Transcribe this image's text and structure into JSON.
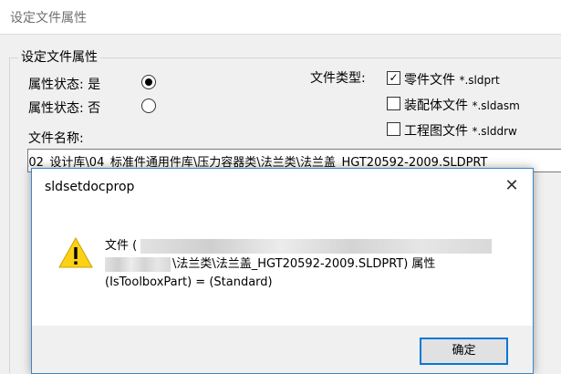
{
  "window": {
    "title": "设定文件属性"
  },
  "group": {
    "title": "设定文件属性"
  },
  "status": {
    "yes_label": "属性状态: 是",
    "no_label": "属性状态: 否",
    "selected": "yes"
  },
  "file_type": {
    "label": "文件类型:",
    "options": [
      {
        "name": "零件文件",
        "ext": "*.sldprt",
        "checked": true
      },
      {
        "name": "装配体文件",
        "ext": "*.sldasm",
        "checked": false
      },
      {
        "name": "工程图文件",
        "ext": "*.slddrw",
        "checked": false
      }
    ]
  },
  "file_name": {
    "label": "文件名称:",
    "value": "\\02_设计库\\04_标准件通用件库\\压力容器类\\法兰类\\法兰盖_HGT20592-2009.SLDPRT"
  },
  "dialog": {
    "title": "sldsetdocprop",
    "close_glyph": "✕",
    "message_line1": "文件 (",
    "message_line2": "\\法兰类\\法兰盖_HGT20592-2009.SLDPRT) 属性",
    "message_line3": "(IsToolboxPart) = (Standard)",
    "ok_label": "确定"
  },
  "colors": {
    "accent": "#0078d7",
    "warning": "#fcd116"
  }
}
